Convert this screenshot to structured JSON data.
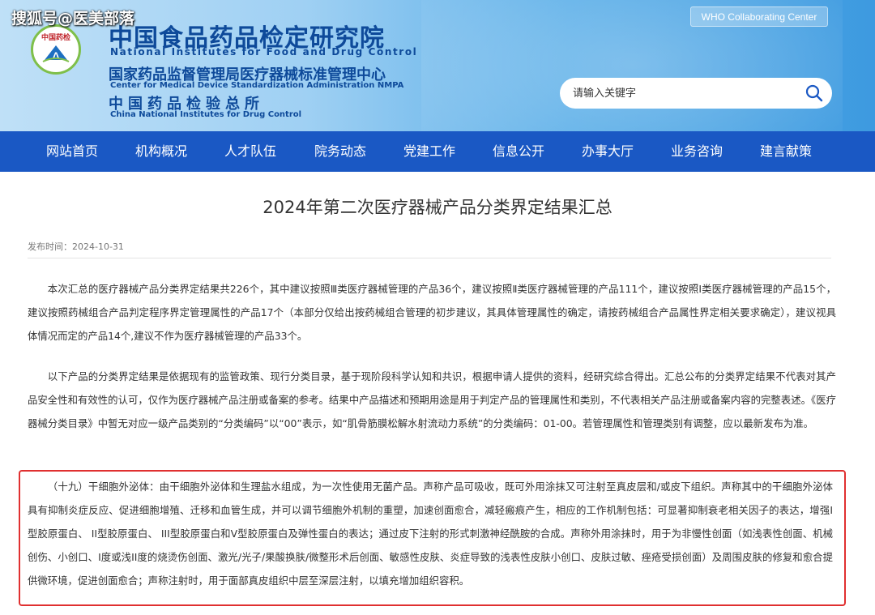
{
  "watermark": "搜狐号@医美部落",
  "header": {
    "logo_text": "中国药检",
    "org_cn_1": "中国食品药品检定研究院",
    "org_en_1": "National Institutes for Food and Drug Control",
    "org_cn_2": "国家药品监督管理局医疗器械标准管理中心",
    "org_en_2": "Center for Medical Device Standardization Administration NMPA",
    "org_cn_3": "中国药品检验总所",
    "org_en_3": "China National Institutes for Drug Control",
    "who_label": "WHO Collaborating Center",
    "search_placeholder": "请输入关键字",
    "brand_color": "#1a58c4"
  },
  "nav": {
    "items": [
      {
        "label": "网站首页"
      },
      {
        "label": "机构概况"
      },
      {
        "label": "人才队伍"
      },
      {
        "label": "院务动态"
      },
      {
        "label": "党建工作"
      },
      {
        "label": "信息公开"
      },
      {
        "label": "办事大厅"
      },
      {
        "label": "业务咨询"
      },
      {
        "label": "建言献策"
      }
    ]
  },
  "article": {
    "title": "2024年第二次医疗器械产品分类界定结果汇总",
    "publish_date": "发布时间：2024-10-31",
    "paragraph_1": "本次汇总的医疗器械产品分类界定结果共226个，其中建议按照Ⅲ类医疗器械管理的产品36个，建议按照Ⅱ类医疗器械管理的产品111个，建议按照Ⅰ类医疗器械管理的产品15个，建议按照药械组合产品判定程序界定管理属性的产品17个（本部分仅给出按药械组合管理的初步建议，其具体管理属性的确定，请按药械组合产品属性界定相关要求确定），建议视具体情况而定的产品14个,建议不作为医疗器械管理的产品33个。",
    "paragraph_2": "以下产品的分类界定结果是依据现有的监管政策、现行分类目录，基于现阶段科学认知和共识，根据申请人提供的资料，经研究综合得出。汇总公布的分类界定结果不代表对其产品安全性和有效性的认可，仅作为医疗器械产品注册或备案的参考。结果中产品描述和预期用途是用于判定产品的管理属性和类别，不代表相关产品注册或备案内容的完整表述。《医疗器械分类目录》中暂无对应一级产品类别的“分类编码”以“00”表示，如“肌骨筋膜松解水射流动力系统”的分类编码：01-00。若管理属性和管理类别有调整，应以最新发布为准。",
    "paragraph_3": "（十九）干细胞外泌体：由干细胞外泌体和生理盐水组成，为一次性使用无菌产品。声称产品可吸收，既可外用涂抹又可注射至真皮层和/或皮下组织。声称其中的干细胞外泌体具有抑制炎症反应、促进细胞增殖、迁移和血管生成，并可以调节细胞外机制的重塑，加速创面愈合，减轻瘢痕产生，相应的工作机制包括：可显著抑制衰老相关因子的表达，增强I型胶原蛋白、 II型胶原蛋白、 III型胶原蛋白和V型胶原蛋白及弹性蛋白的表达；通过皮下注射的形式刺激神经酰胺的合成。声称外用涂抹时，用于为非慢性创面（如浅表性创面、机械创伤、小创口、I度或浅II度的烧烫伤创面、激光/光子/果酸换肤/微整形术后创面、敏感性皮肤、炎症导致的浅表性皮肤小创口、皮肤过敏、痤疮受损创面）及周围皮肤的修复和愈合提供微环境，促进创面愈合；声称注射时，用于面部真皮组织中层至深层注射，以填充增加组织容积。",
    "highlight_color": "#e03030"
  }
}
